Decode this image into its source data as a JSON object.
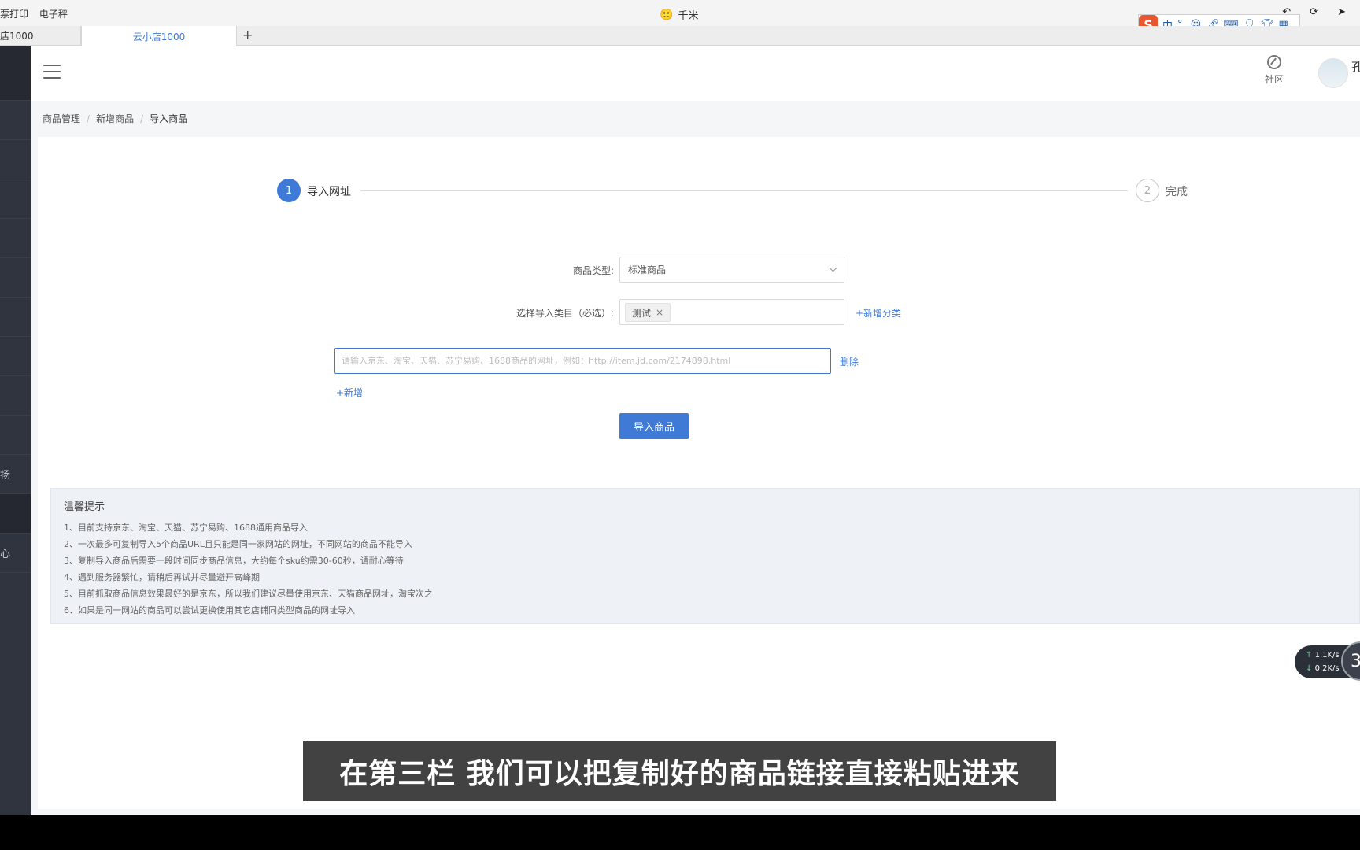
{
  "topbar": {
    "links": [
      "票打印",
      "电子秤"
    ],
    "window_title": "千米",
    "window_title_icon": "smiley-emoji",
    "ime": {
      "logo": "S",
      "mode": "中",
      "items": [
        "°,",
        "☺",
        "mic",
        "keyboard",
        "user",
        "shirt",
        "grid"
      ]
    }
  },
  "tabs": {
    "previous": "店1000",
    "active": "云小店1000",
    "add": "+"
  },
  "sidebar": {
    "items": [
      "",
      "",
      "",
      "",
      "",
      "",
      "",
      "",
      "",
      "扬",
      "",
      "心"
    ]
  },
  "header": {
    "community": "社区",
    "user_name": "孔"
  },
  "breadcrumb": [
    "商品管理",
    "新增商品",
    "导入商品"
  ],
  "steps": [
    {
      "num": "1",
      "title": "导入网址",
      "active": true
    },
    {
      "num": "2",
      "title": "完成",
      "active": false
    }
  ],
  "form": {
    "type_label": "商品类型:",
    "type_value": "标准商品",
    "category_label": "选择导入类目（必选）:",
    "category_tag": "测试",
    "add_category": "+新增分类",
    "url_placeholder": "请输入京东、淘宝、天猫、苏宁易购、1688商品的网址，例如：http://item.jd.com/2174898.html",
    "url_value": "",
    "delete": "删除",
    "add_row": "+新增",
    "import_button": "导入商品"
  },
  "tips": {
    "title": "温馨提示",
    "lines": [
      "1、目前支持京东、淘宝、天猫、苏宁易购、1688通用商品导入",
      "2、一次最多可复制导入5个商品URL且只能是同一家网站的网址，不同网站的商品不能导入",
      "3、复制导入商品后需要一段时间同步商品信息，大约每个sku约需30-60秒，请耐心等待",
      "4、遇到服务器繁忙，请稍后再试并尽量避开高峰期",
      "5、目前抓取商品信息效果最好的是京东，所以我们建议尽量使用京东、天猫商品网址，淘宝次之",
      "6、如果是同一网站的商品可以尝试更换使用其它店铺同类型商品的网址导入"
    ]
  },
  "speed": {
    "up": "1.1",
    "down": "0.2",
    "unit": "K/s",
    "ball": "3"
  },
  "subtitle": "在第三栏 我们可以把复制好的商品链接直接粘贴进来",
  "colors": {
    "primary": "#3f7bd6",
    "sidebar": "#30343f",
    "tips_bg": "#eef2f7"
  }
}
